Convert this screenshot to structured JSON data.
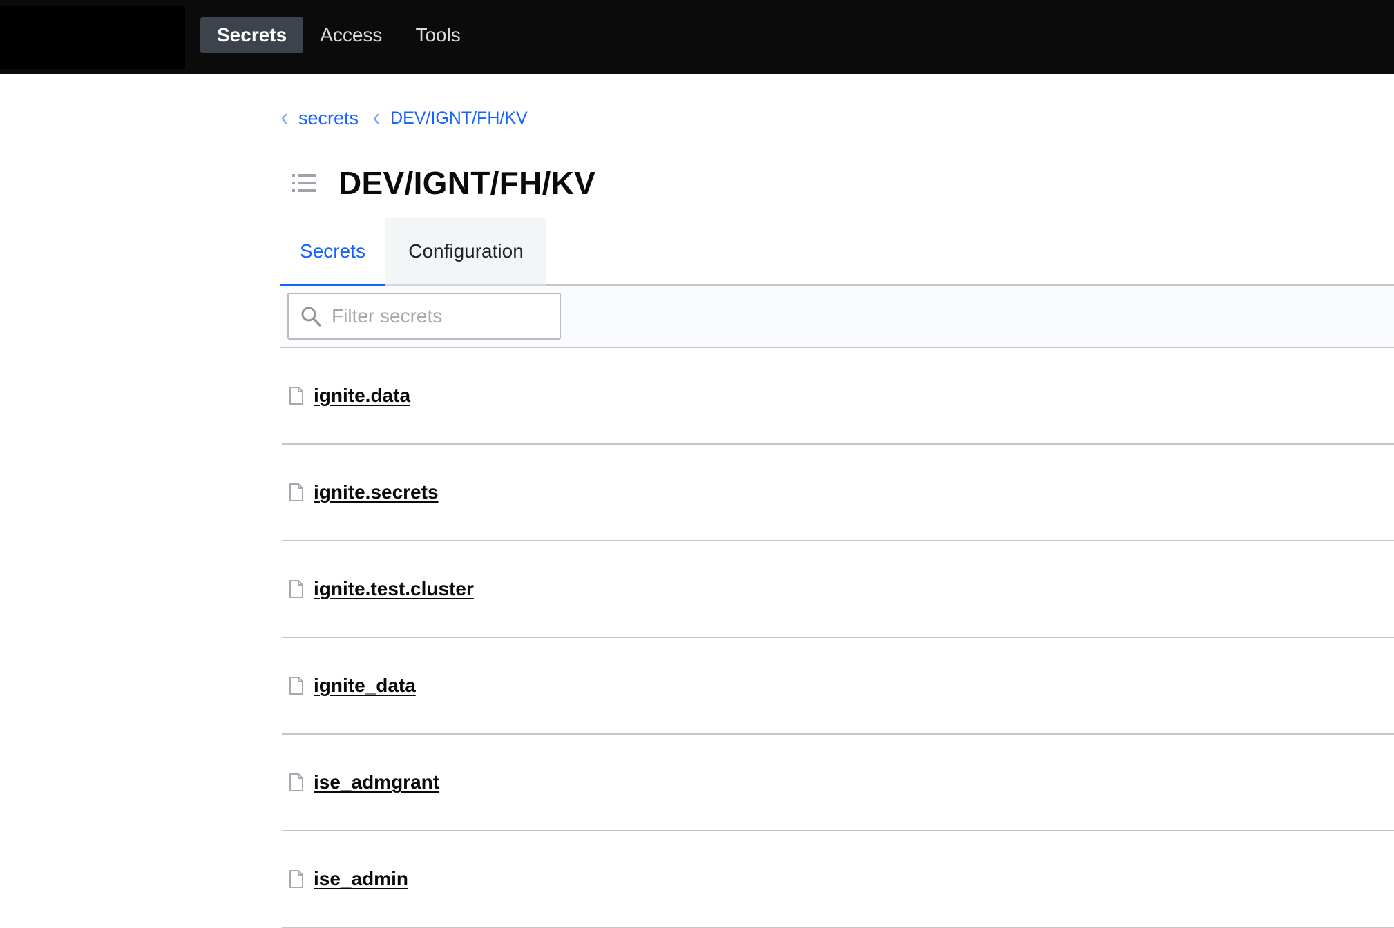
{
  "nav": {
    "items": [
      {
        "label": "Secrets",
        "active": true
      },
      {
        "label": "Access",
        "active": false
      },
      {
        "label": "Tools",
        "active": false
      }
    ]
  },
  "breadcrumb": [
    {
      "label": "secrets"
    },
    {
      "label": "DEV/IGNT/FH/KV"
    }
  ],
  "page": {
    "title": "DEV/IGNT/FH/KV",
    "icon": "list-icon"
  },
  "tabs": [
    {
      "label": "Secrets",
      "active": true
    },
    {
      "label": "Configuration",
      "active": false
    }
  ],
  "filter": {
    "placeholder": "Filter secrets",
    "value": ""
  },
  "secrets": [
    {
      "name": "ignite.data",
      "icon": "file-icon"
    },
    {
      "name": "ignite.secrets",
      "icon": "file-icon"
    },
    {
      "name": "ignite.test.cluster",
      "icon": "file-icon"
    },
    {
      "name": "ignite_data",
      "icon": "file-icon"
    },
    {
      "name": "ise_admgrant",
      "icon": "file-icon"
    },
    {
      "name": "ise_admin",
      "icon": "file-icon"
    }
  ],
  "colors": {
    "topbar": "#0b0b0b",
    "nav_active_bg": "#3d434d",
    "link_blue": "#1563ff",
    "divider": "#c2c5cb"
  }
}
